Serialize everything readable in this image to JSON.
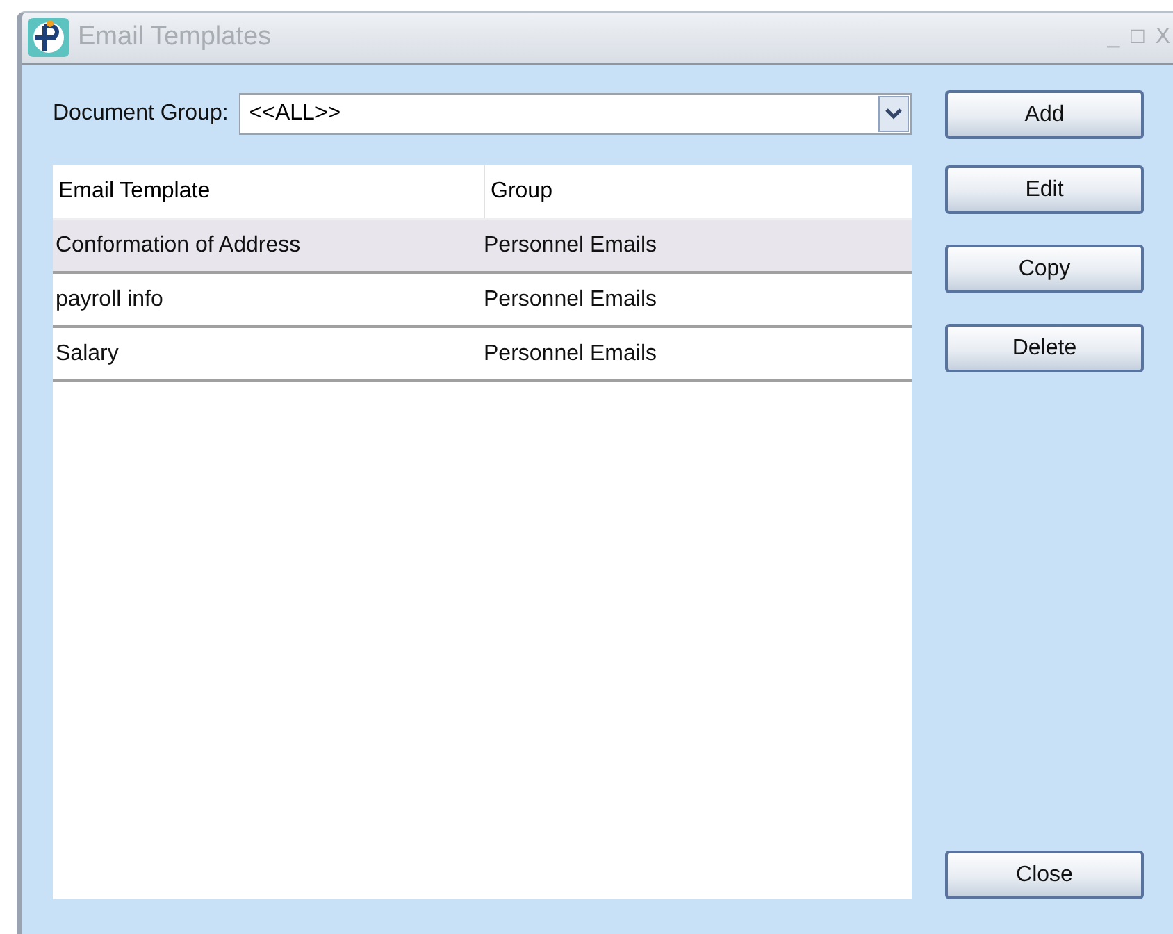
{
  "window": {
    "title": "Email Templates",
    "controls": [
      "_",
      "□",
      "X"
    ]
  },
  "filter": {
    "label": "Document Group:",
    "value": "<<ALL>>"
  },
  "table": {
    "columns": [
      "Email Template",
      "Group"
    ],
    "rows": [
      {
        "cells": [
          "Conformation of Address",
          "Personnel Emails"
        ],
        "selected": true
      },
      {
        "cells": [
          "payroll info",
          "Personnel Emails"
        ],
        "selected": false
      },
      {
        "cells": [
          "Salary",
          "Personnel Emails"
        ],
        "selected": false
      }
    ]
  },
  "buttons": [
    "Add",
    "Edit",
    "Copy",
    "Delete"
  ],
  "close_button": "Close"
}
